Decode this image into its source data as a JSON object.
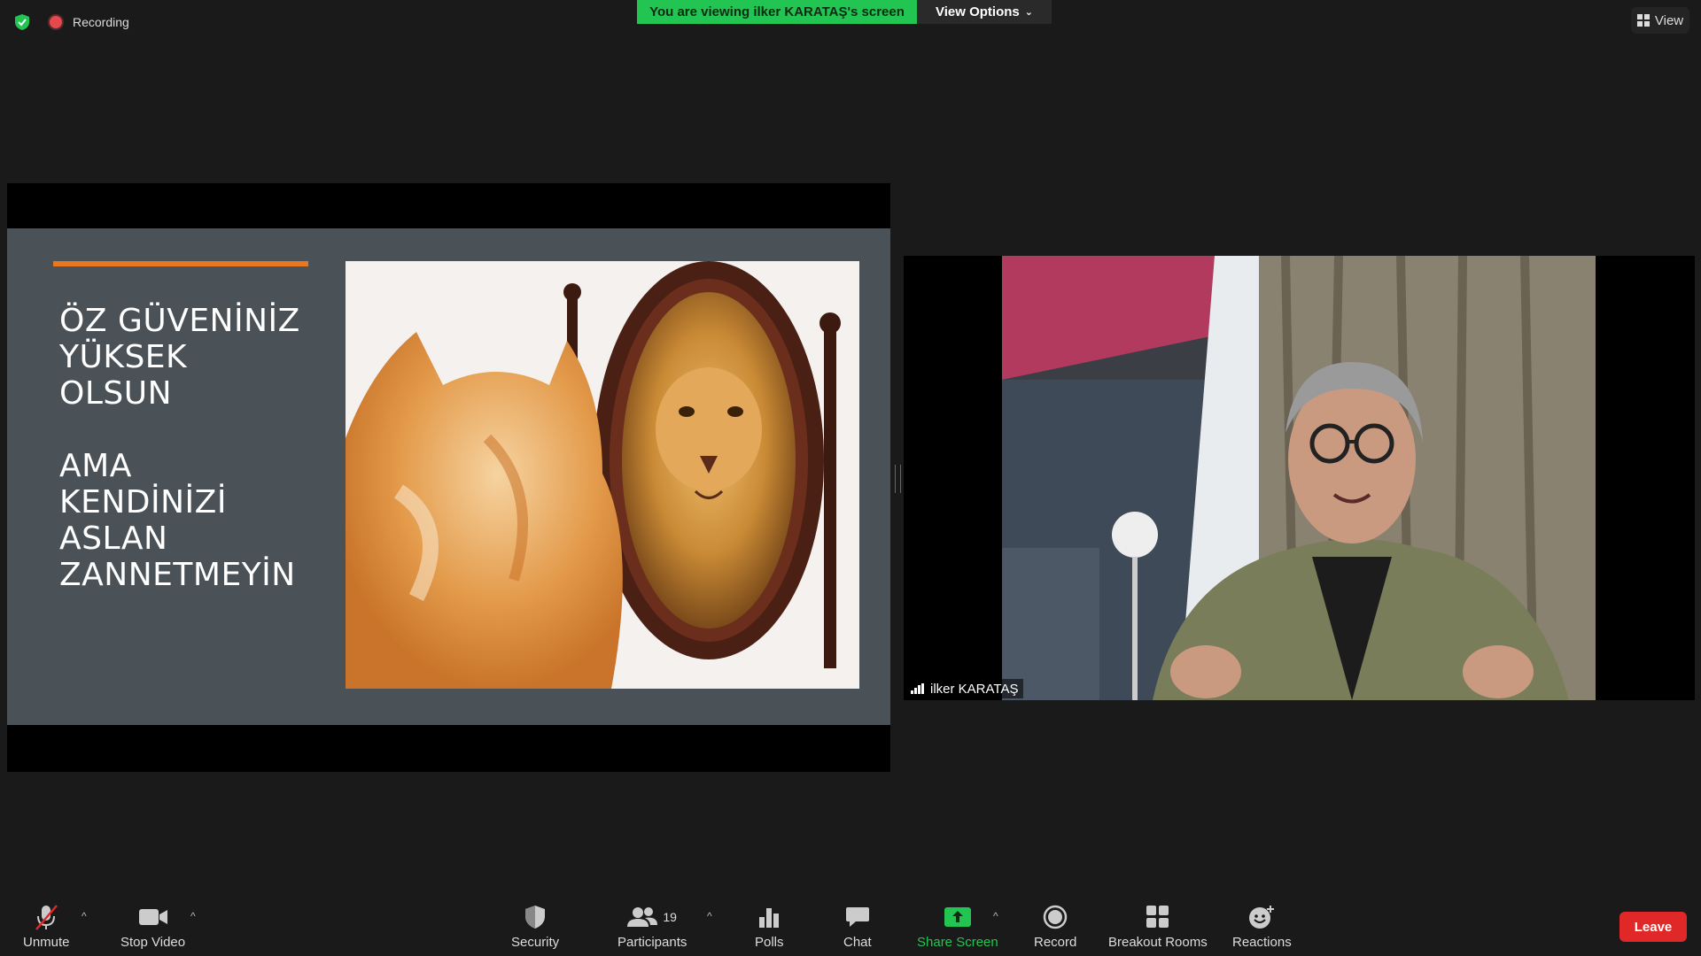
{
  "topbar": {
    "recording_label": "Recording",
    "viewing_banner": "You are viewing ilker KARATAŞ's screen",
    "view_options_label": "View Options",
    "view_label": "View"
  },
  "slide": {
    "line1": "ÖZ GÜVENİNİZ",
    "line2": "YÜKSEK OLSUN",
    "line3": "AMA KENDİNİZİ",
    "line4": "ASLAN",
    "line5": "ZANNETMEYİN",
    "accent_color": "#e87722"
  },
  "video": {
    "participant_name": "ilker KARATAŞ"
  },
  "toolbar": {
    "unmute": "Unmute",
    "stop_video": "Stop Video",
    "security": "Security",
    "participants": "Participants",
    "participants_count": "19",
    "polls": "Polls",
    "chat": "Chat",
    "share_screen": "Share Screen",
    "record": "Record",
    "breakout_rooms": "Breakout Rooms",
    "reactions": "Reactions",
    "leave": "Leave",
    "share_color": "#23c552"
  }
}
